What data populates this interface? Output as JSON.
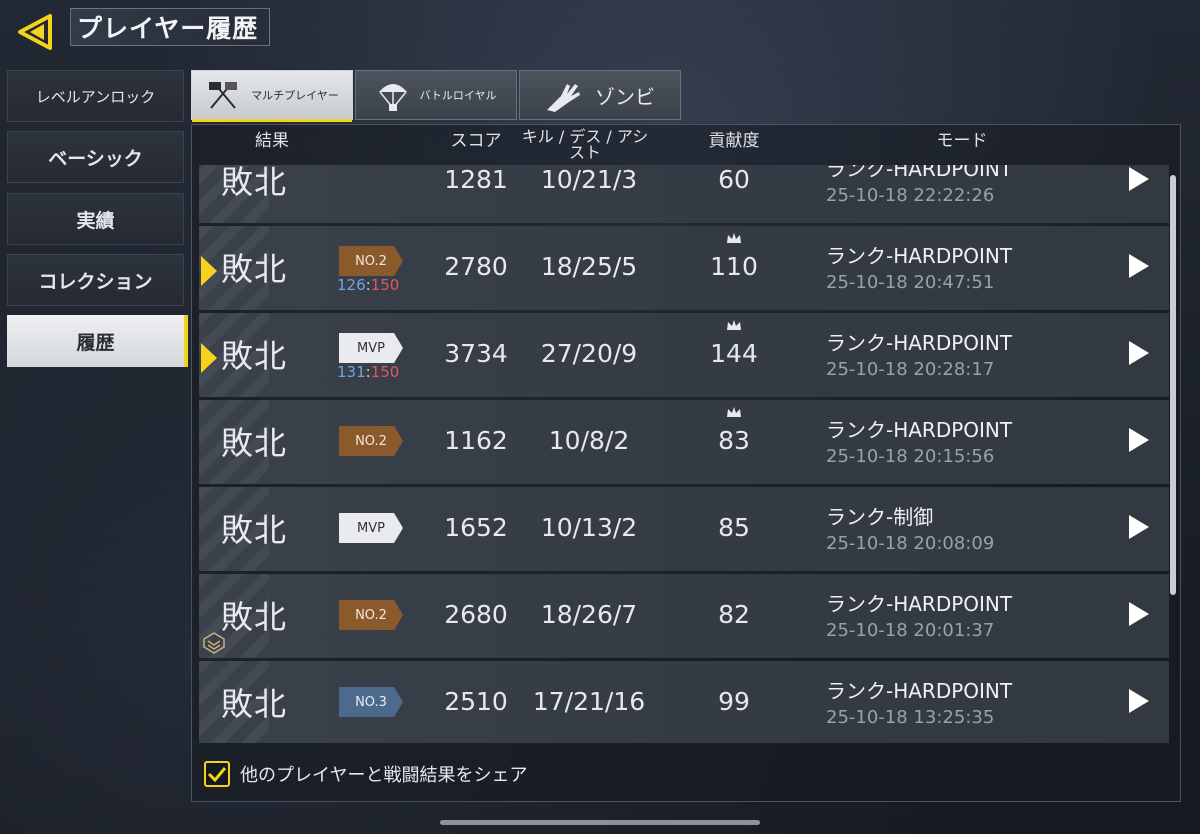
{
  "header": {
    "title": "プレイヤー履歴"
  },
  "sidebar": {
    "items": [
      {
        "label": "レベルアンロック"
      },
      {
        "label": "ベーシック"
      },
      {
        "label": "実績"
      },
      {
        "label": "コレクション"
      },
      {
        "label": "履歴"
      }
    ]
  },
  "tabs": [
    {
      "label": "マルチプレイヤー"
    },
    {
      "label": "バトルロイヤル"
    },
    {
      "label": "ゾンビ"
    }
  ],
  "columns": {
    "result": "結果",
    "score": "スコア",
    "kda": "キル / デス / アシスト",
    "contribution": "貢献度",
    "mode": "モード"
  },
  "rows": [
    {
      "result": "敗北",
      "badge": "",
      "team_blue": "",
      "sep": "",
      "team_red": "",
      "score": "1281",
      "kda": "10/21/3",
      "contribution": "60",
      "mode": "ランク-HARDPOINT",
      "datetime": "25-10-18 22:22:26"
    },
    {
      "result": "敗北",
      "badge": "NO.2",
      "team_blue": "126",
      "sep": ":",
      "team_red": "150",
      "score": "2780",
      "kda": "18/25/5",
      "contribution": "110",
      "mode": "ランク-HARDPOINT",
      "datetime": "25-10-18 20:47:51"
    },
    {
      "result": "敗北",
      "badge": "MVP",
      "team_blue": "131",
      "sep": ":",
      "team_red": "150",
      "score": "3734",
      "kda": "27/20/9",
      "contribution": "144",
      "mode": "ランク-HARDPOINT",
      "datetime": "25-10-18 20:28:17"
    },
    {
      "result": "敗北",
      "badge": "NO.2",
      "team_blue": "",
      "sep": "",
      "team_red": "",
      "score": "1162",
      "kda": "10/8/2",
      "contribution": "83",
      "mode": "ランク-HARDPOINT",
      "datetime": "25-10-18 20:15:56"
    },
    {
      "result": "敗北",
      "badge": "MVP",
      "team_blue": "",
      "sep": "",
      "team_red": "",
      "score": "1652",
      "kda": "10/13/2",
      "contribution": "85",
      "mode": "ランク-制御",
      "datetime": "25-10-18 20:08:09"
    },
    {
      "result": "敗北",
      "badge": "NO.2",
      "team_blue": "",
      "sep": "",
      "team_red": "",
      "score": "2680",
      "kda": "18/26/7",
      "contribution": "82",
      "mode": "ランク-HARDPOINT",
      "datetime": "25-10-18 20:01:37"
    },
    {
      "result": "敗北",
      "badge": "NO.3",
      "team_blue": "",
      "sep": "",
      "team_red": "",
      "score": "2510",
      "kda": "17/21/16",
      "contribution": "99",
      "mode": "ランク-HARDPOINT",
      "datetime": "25-10-18 13:25:35"
    }
  ],
  "share": {
    "label": "他のプレイヤーと戦闘結果をシェア",
    "checked": true
  },
  "colors": {
    "accent": "#f5d21c",
    "badge_no2": "#8a5a2c",
    "badge_mvp": "#e9ebee",
    "badge_no3": "#4c6a8c",
    "team_blue": "#6ba7e6",
    "team_red": "#e0575f"
  }
}
